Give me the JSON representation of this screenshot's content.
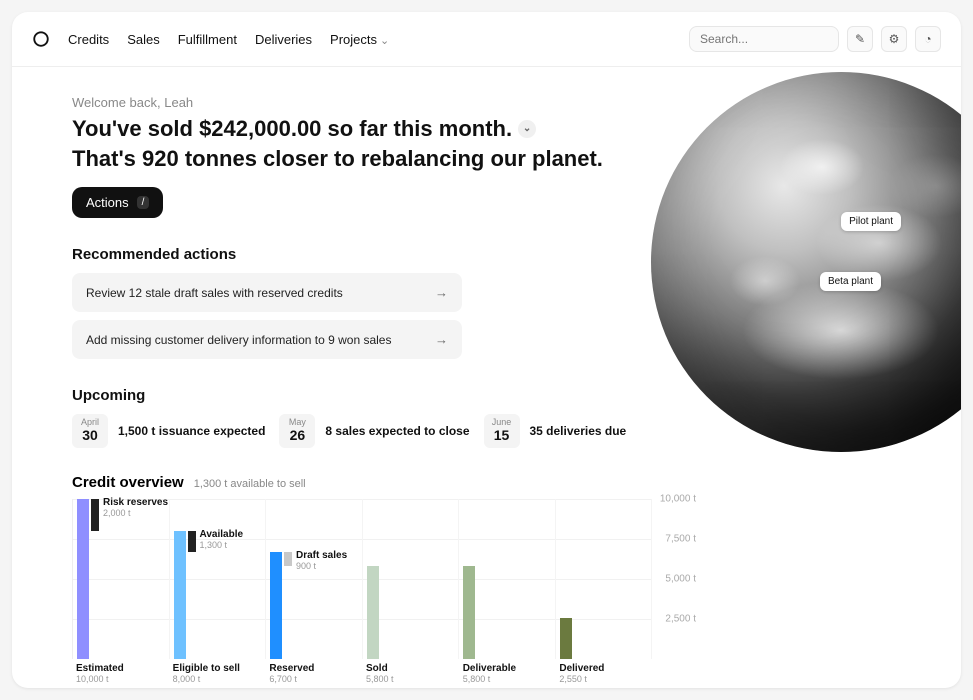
{
  "nav": {
    "items": [
      "Credits",
      "Sales",
      "Fulfillment",
      "Deliveries",
      "Projects"
    ]
  },
  "search": {
    "placeholder": "Search..."
  },
  "welcome": "Welcome back, Leah",
  "headline": {
    "line1": "You've sold $242,000.00 so far this month.",
    "line2": "That's 920 tonnes closer to rebalancing our planet."
  },
  "actions_label": "Actions",
  "actions_kbd": "/",
  "recommended": {
    "title": "Recommended actions",
    "items": [
      "Review 12 stale draft sales with reserved credits",
      "Add missing customer delivery information to 9 won sales"
    ]
  },
  "upcoming": {
    "title": "Upcoming",
    "items": [
      {
        "month": "April",
        "day": "30",
        "text": "1,500 t issuance expected"
      },
      {
        "month": "May",
        "day": "26",
        "text": "8 sales expected to close"
      },
      {
        "month": "June",
        "day": "15",
        "text": "35 deliveries due"
      }
    ]
  },
  "credit": {
    "title": "Credit overview",
    "subtitle": "1,300 t available to sell"
  },
  "globe": {
    "pin1": "Pilot plant",
    "pin2": "Beta plant"
  },
  "chart_data": {
    "type": "bar",
    "title": "Credit overview",
    "ylabel": "t",
    "ylim": [
      0,
      10000
    ],
    "y_ticks": [
      2500,
      5000,
      7500,
      10000
    ],
    "y_tick_labels": [
      "2,500 t",
      "5,000 t",
      "7,500 t",
      "10,000 t"
    ],
    "categories": [
      "Estimated",
      "Eligible to sell",
      "Reserved",
      "Sold",
      "Deliverable",
      "Delivered"
    ],
    "values": [
      10000,
      8000,
      6700,
      5800,
      5800,
      2550
    ],
    "value_labels": [
      "10,000 t",
      "8,000 t",
      "6,700 t",
      "5,800 t",
      "5,800 t",
      "2,550 t"
    ],
    "colors": [
      "#8f8fff",
      "#6ec1ff",
      "#1f8fff",
      "#c2d6c2",
      "#9fb88f",
      "#6b7a3f"
    ],
    "annotations": [
      {
        "label": "Risk reserves",
        "value": 2000,
        "value_label": "2,000 t",
        "after_index": 0
      },
      {
        "label": "Available",
        "value": 1300,
        "value_label": "1,300 t",
        "after_index": 1
      },
      {
        "label": "Draft sales",
        "value": 900,
        "value_label": "900 t",
        "after_index": 2
      }
    ]
  }
}
